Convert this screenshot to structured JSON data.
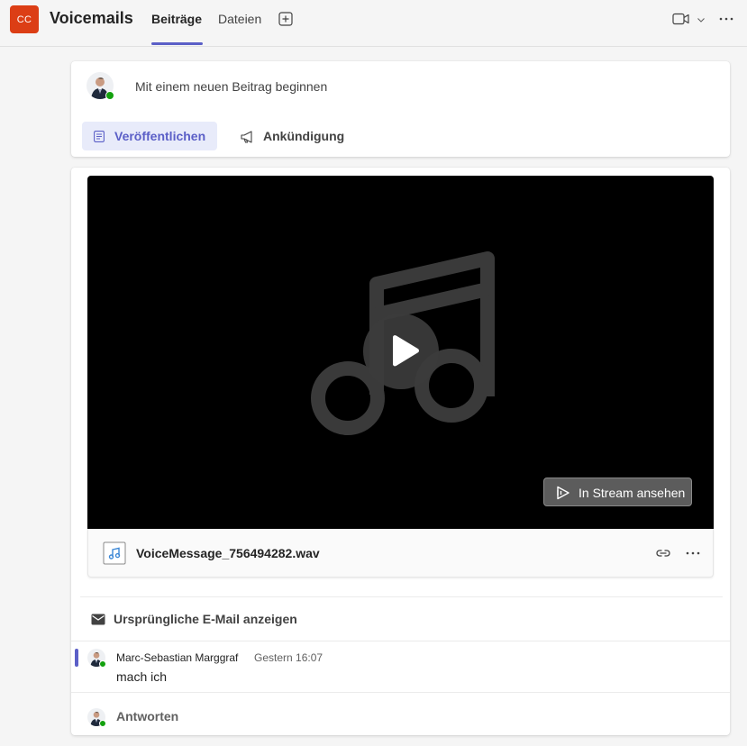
{
  "header": {
    "team_initials": "CC",
    "channel_title": "Voicemails",
    "tabs": [
      {
        "label": "Beiträge",
        "active": true
      },
      {
        "label": "Dateien",
        "active": false
      }
    ],
    "icons": [
      "add-tab-icon",
      "video-camera-icon",
      "chevron-down-icon",
      "more-icon"
    ]
  },
  "compose": {
    "placeholder": "Mit einem neuen Beitrag beginnen",
    "publish_label": "Veröffentlichen",
    "announce_label": "Ankündigung"
  },
  "message": {
    "video": {
      "stream_label": "In Stream ansehen"
    },
    "file_name": "VoiceMessage_756494282.wav",
    "email_label": "Ursprüngliche E-Mail anzeigen",
    "reply": {
      "author": "Marc-Sebastian Marggraf",
      "time": "Gestern 16:07",
      "text": "mach ich"
    },
    "answer_label": "Antworten"
  },
  "colors": {
    "accent": "#5b5fc7",
    "team_avatar": "#dc3e15",
    "presence": "#13a10e"
  }
}
